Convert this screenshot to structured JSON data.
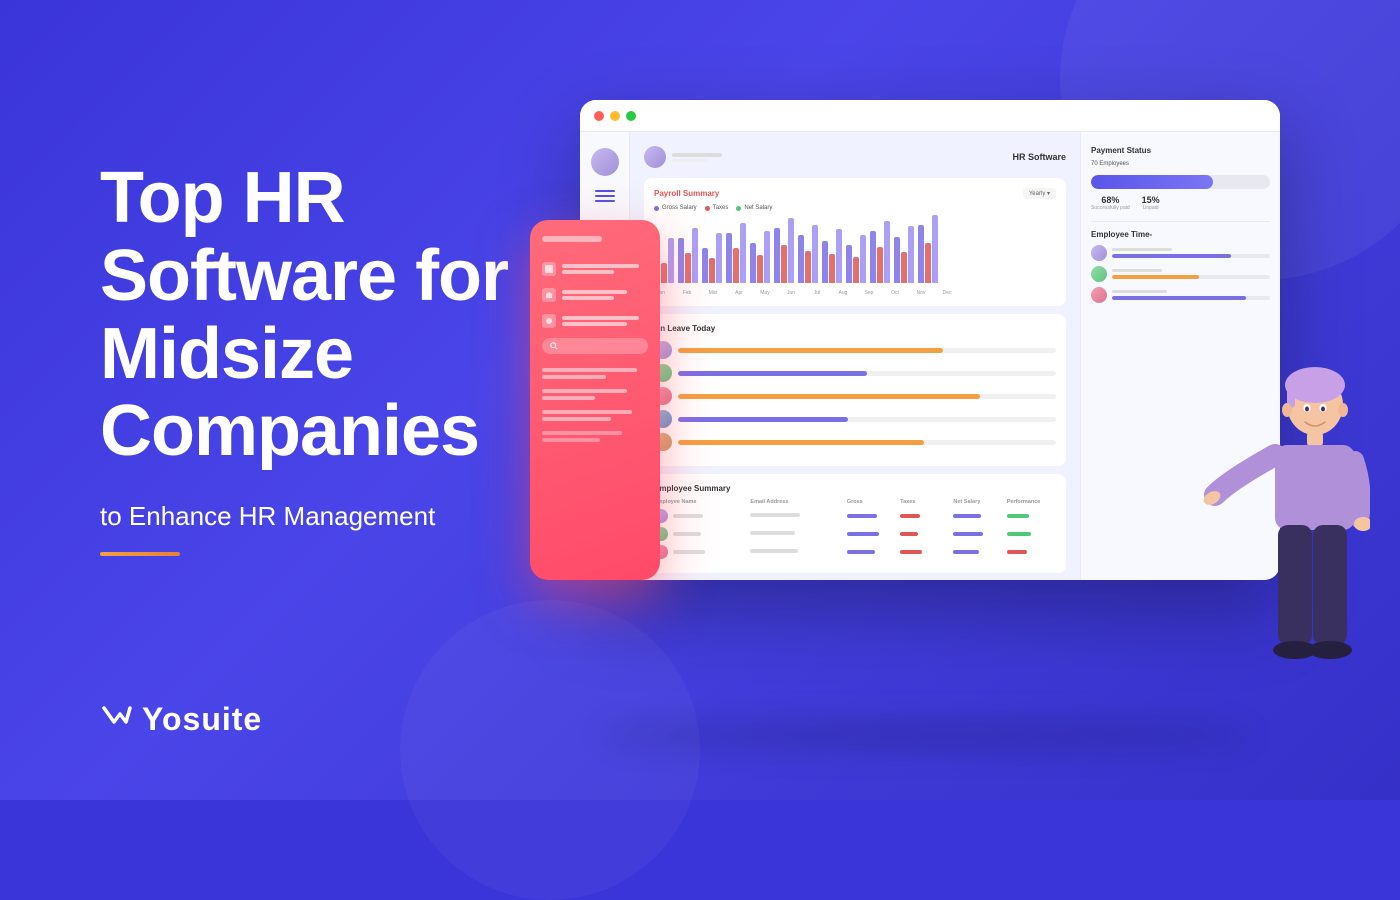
{
  "background": {
    "color": "#3a35d9"
  },
  "heading": {
    "line1": "Top HR",
    "line2": "Software for",
    "line3": "Midsize",
    "line4": "Companies"
  },
  "subheading": "to Enhance HR Management",
  "logo": {
    "text": "Yosuite",
    "icon": "✓"
  },
  "dashboard": {
    "title": "HR Software",
    "titlebar_dots": [
      "red",
      "yellow",
      "green"
    ],
    "payroll": {
      "title": "Payroll Summary",
      "filter": "Yearly ▾",
      "legend": [
        {
          "label": "Gross Salary",
          "color": "#7b6fe8"
        },
        {
          "label": "Taxes",
          "color": "#e05555"
        },
        {
          "label": "Net Salary",
          "color": "#50c878"
        }
      ],
      "bars": [
        {
          "month": "Jan",
          "h1": 30,
          "h2": 20,
          "h3": 45
        },
        {
          "month": "Feb",
          "h1": 45,
          "h2": 30,
          "h3": 55
        },
        {
          "month": "Mar",
          "h1": 35,
          "h2": 25,
          "h3": 50
        },
        {
          "month": "Apr",
          "h1": 50,
          "h2": 35,
          "h3": 60
        },
        {
          "month": "May",
          "h1": 40,
          "h2": 28,
          "h3": 52
        },
        {
          "month": "Jun",
          "h1": 55,
          "h2": 38,
          "h3": 65
        },
        {
          "month": "Jul",
          "h1": 48,
          "h2": 32,
          "h3": 58
        },
        {
          "month": "Aug",
          "h1": 42,
          "h2": 29,
          "h3": 54
        },
        {
          "month": "Sep",
          "h1": 38,
          "h2": 26,
          "h3": 48
        },
        {
          "month": "Oct",
          "h1": 52,
          "h2": 36,
          "h3": 62
        },
        {
          "month": "Nov",
          "h1": 46,
          "h2": 31,
          "h3": 57
        },
        {
          "month": "Dec",
          "h1": 58,
          "h2": 40,
          "h3": 68
        }
      ]
    },
    "leave": {
      "title": "On Leave Today",
      "employees": [
        {
          "color": "#a090d8",
          "bar_color": "#f4a042",
          "bar_width": "70%"
        },
        {
          "color": "#90c8a0",
          "bar_color": "#7b6fe8",
          "bar_width": "50%"
        },
        {
          "color": "#f090a0",
          "bar_color": "#f4a042",
          "bar_width": "80%"
        },
        {
          "color": "#80b0e0",
          "bar_color": "#7b6fe8",
          "bar_width": "45%"
        },
        {
          "color": "#c8a090",
          "bar_color": "#f4a042",
          "bar_width": "65%"
        }
      ]
    },
    "summary": {
      "title": "Employee Summary",
      "columns": [
        "Employee Name",
        "Email Address",
        "Gross",
        "Taxes",
        "Net Salary",
        "Performance"
      ],
      "rows": [
        {
          "avatar": "#a090d8",
          "name_bar": "#ddd",
          "email_bar": "#ddd",
          "gross": "#7b6fe8",
          "taxes": "#e05555",
          "net": "#7b6fe8",
          "perf": "#50c878"
        },
        {
          "avatar": "#90c8a0",
          "name_bar": "#ddd",
          "email_bar": "#ddd",
          "gross": "#7b6fe8",
          "taxes": "#e05555",
          "net": "#7b6fe8",
          "perf": "#50c878"
        },
        {
          "avatar": "#f090a0",
          "name_bar": "#ddd",
          "email_bar": "#ddd",
          "gross": "#7b6fe8",
          "taxes": "#e05555",
          "net": "#7b6fe8",
          "perf": "#e05555"
        }
      ]
    },
    "payment_status": {
      "title": "Payment Status",
      "employees": "70 Employees",
      "bar_percent": 68,
      "stats": [
        {
          "value": "68%",
          "label": "Successfully paid"
        },
        {
          "value": "15%",
          "label": "Unpaid"
        }
      ]
    },
    "employee_time": {
      "title": "Employee Time-",
      "items": [
        {
          "avatar": "#a090d8",
          "bar_color": "#7b6fe8",
          "bar_width": "75%"
        },
        {
          "avatar": "#90c8a0",
          "bar_color": "#f4a042",
          "bar_width": "55%"
        },
        {
          "avatar": "#f090a0",
          "bar_color": "#7b6fe8",
          "bar_width": "85%"
        }
      ]
    }
  }
}
